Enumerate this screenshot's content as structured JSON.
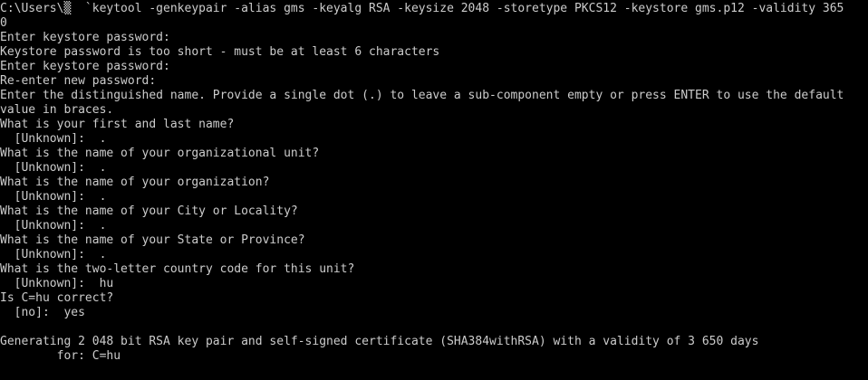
{
  "terminal": {
    "background": "#000000",
    "foreground": "#cccccc",
    "lines": [
      "C:\\Users\\▒  `keytool -genkeypair -alias gms -keyalg RSA -keysize 2048 -storetype PKCS12 -keystore gms.p12 -validity 365",
      "0",
      "Enter keystore password:",
      "Keystore password is too short - must be at least 6 characters",
      "Enter keystore password:",
      "Re-enter new password:",
      "Enter the distinguished name. Provide a single dot (.) to leave a sub-component empty or press ENTER to use the default",
      "value in braces.",
      "What is your first and last name?",
      "  [Unknown]:  .",
      "What is the name of your organizational unit?",
      "  [Unknown]:  .",
      "What is the name of your organization?",
      "  [Unknown]:  .",
      "What is the name of your City or Locality?",
      "  [Unknown]:  .",
      "What is the name of your State or Province?",
      "  [Unknown]:  .",
      "What is the two-letter country code for this unit?",
      "  [Unknown]:  hu",
      "Is C=hu correct?",
      "  [no]:  yes",
      "",
      "Generating 2 048 bit RSA key pair and self-signed certificate (SHA384withRSA) with a validity of 3 650 days",
      "        for: C=hu"
    ]
  }
}
